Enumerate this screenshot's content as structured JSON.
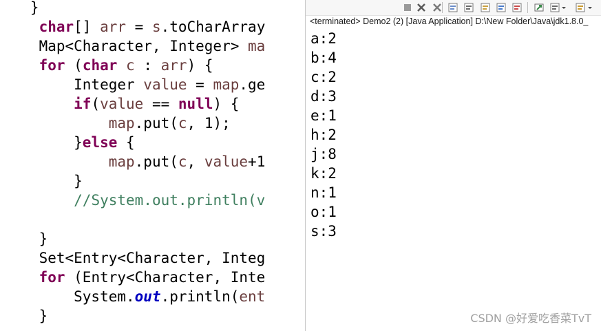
{
  "editor": {
    "lines": [
      [
        {
          "t": "   }",
          "c": "plain"
        }
      ],
      [
        {
          "t": "    ",
          "c": "plain"
        },
        {
          "t": "char",
          "c": "keyword"
        },
        {
          "t": "[] ",
          "c": "plain"
        },
        {
          "t": "arr",
          "c": "var"
        },
        {
          "t": " = ",
          "c": "plain"
        },
        {
          "t": "s",
          "c": "var"
        },
        {
          "t": ".toCharArray",
          "c": "plain"
        }
      ],
      [
        {
          "t": "    Map<Character, Integer> ",
          "c": "plain"
        },
        {
          "t": "ma",
          "c": "var"
        }
      ],
      [
        {
          "t": "    ",
          "c": "plain"
        },
        {
          "t": "for",
          "c": "keyword"
        },
        {
          "t": " (",
          "c": "plain"
        },
        {
          "t": "char",
          "c": "keyword"
        },
        {
          "t": " ",
          "c": "plain"
        },
        {
          "t": "c",
          "c": "var"
        },
        {
          "t": " : ",
          "c": "plain"
        },
        {
          "t": "arr",
          "c": "var"
        },
        {
          "t": ") {",
          "c": "plain"
        }
      ],
      [
        {
          "t": "        Integer ",
          "c": "plain"
        },
        {
          "t": "value",
          "c": "var"
        },
        {
          "t": " = ",
          "c": "plain"
        },
        {
          "t": "map",
          "c": "var"
        },
        {
          "t": ".ge",
          "c": "plain"
        }
      ],
      [
        {
          "t": "        ",
          "c": "plain"
        },
        {
          "t": "if",
          "c": "keyword"
        },
        {
          "t": "(",
          "c": "plain"
        },
        {
          "t": "value",
          "c": "var"
        },
        {
          "t": " == ",
          "c": "plain"
        },
        {
          "t": "null",
          "c": "keyword"
        },
        {
          "t": ") {",
          "c": "plain"
        }
      ],
      [
        {
          "t": "            ",
          "c": "plain"
        },
        {
          "t": "map",
          "c": "var"
        },
        {
          "t": ".put(",
          "c": "plain"
        },
        {
          "t": "c",
          "c": "var"
        },
        {
          "t": ", 1);",
          "c": "plain"
        }
      ],
      [
        {
          "t": "        }",
          "c": "plain"
        },
        {
          "t": "else",
          "c": "keyword"
        },
        {
          "t": " {",
          "c": "plain"
        }
      ],
      [
        {
          "t": "            ",
          "c": "plain"
        },
        {
          "t": "map",
          "c": "var"
        },
        {
          "t": ".put(",
          "c": "plain"
        },
        {
          "t": "c",
          "c": "var"
        },
        {
          "t": ", ",
          "c": "plain"
        },
        {
          "t": "value",
          "c": "var"
        },
        {
          "t": "+1",
          "c": "plain"
        }
      ],
      [
        {
          "t": "        }",
          "c": "plain"
        }
      ],
      [
        {
          "t": "        ",
          "c": "plain"
        },
        {
          "t": "//System.out.println(v",
          "c": "comment"
        }
      ],
      [
        {
          "t": "",
          "c": "plain"
        }
      ],
      [
        {
          "t": "    }",
          "c": "plain"
        }
      ],
      [
        {
          "t": "    Set<Entry<Character, Integ",
          "c": "plain"
        }
      ],
      [
        {
          "t": "    ",
          "c": "plain"
        },
        {
          "t": "for",
          "c": "keyword"
        },
        {
          "t": " (Entry<Character, Inte",
          "c": "plain"
        }
      ],
      [
        {
          "t": "        System.",
          "c": "plain"
        },
        {
          "t": "out",
          "c": "field"
        },
        {
          "t": ".println(",
          "c": "plain"
        },
        {
          "t": "ent",
          "c": "var"
        }
      ],
      [
        {
          "t": "    }",
          "c": "plain"
        }
      ]
    ]
  },
  "console": {
    "status": "<terminated> Demo2 (2) [Java Application] D:\\New Folder\\Java\\jdk1.8.0_",
    "toolbar": [
      {
        "name": "terminate-icon",
        "color": "#9a9a9a"
      },
      {
        "name": "remove-launch-icon",
        "color": "#5a5a5a"
      },
      {
        "name": "remove-all-terminated-icon",
        "color": "#7a7a7a"
      },
      {
        "name": "sep"
      },
      {
        "name": "clear-console-icon",
        "color": "#6a8cc8"
      },
      {
        "name": "scroll-lock-icon",
        "color": "#6a6a6a"
      },
      {
        "name": "word-wrap-icon",
        "color": "#c8a040"
      },
      {
        "name": "show-on-stdout-icon",
        "color": "#4a7ac8"
      },
      {
        "name": "show-on-stderr-icon",
        "color": "#c84a4a"
      },
      {
        "name": "sep"
      },
      {
        "name": "pin-console-icon",
        "color": "#3a8a4a"
      },
      {
        "name": "display-console-icon",
        "color": "#6a6a6a"
      },
      {
        "name": "display-console-dropdown-icon",
        "color": "#4a4a4a"
      },
      {
        "name": "open-console-icon",
        "color": "#c89a30"
      },
      {
        "name": "open-console-dropdown-icon",
        "color": "#4a4a4a"
      }
    ],
    "output": [
      "a:2",
      "b:4",
      "c:2",
      "d:3",
      "e:1",
      "h:2",
      "j:8",
      "k:2",
      "n:1",
      "o:1",
      "s:3"
    ]
  },
  "watermark": "CSDN @好爱吃香菜TvT"
}
